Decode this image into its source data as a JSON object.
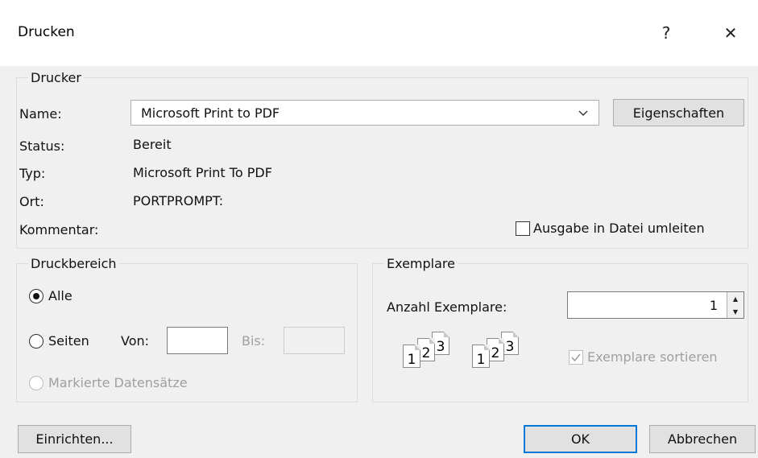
{
  "window": {
    "title": "Drucken",
    "help_icon": "?",
    "close_icon": "✕"
  },
  "printer_group": {
    "legend": "Drucker",
    "name_label": "Name:",
    "name_value": "Microsoft Print to PDF",
    "properties_button": "Eigenschaften",
    "status_label": "Status:",
    "status_value": "Bereit",
    "type_label": "Typ:",
    "type_value": "Microsoft Print To PDF",
    "location_label": "Ort:",
    "location_value": "PORTPROMPT:",
    "comment_label": "Kommentar:",
    "print_to_file_label": "Ausgabe in Datei umleiten",
    "print_to_file_checked": false
  },
  "range_group": {
    "legend": "Druckbereich",
    "all_label": "Alle",
    "pages_label": "Seiten",
    "from_label": "Von:",
    "from_value": "",
    "to_label": "Bis:",
    "to_value": "",
    "selected_records_label": "Markierte Datensätze",
    "selected": "all"
  },
  "copies_group": {
    "legend": "Exemplare",
    "count_label": "Anzahl Exemplare:",
    "count_value": "1",
    "collate_label": "Exemplare sortieren",
    "collate_checked": true,
    "collate_pages": [
      "1",
      "2",
      "3"
    ]
  },
  "footer": {
    "setup_button": "Einrichten...",
    "ok_button": "OK",
    "cancel_button": "Abbrechen"
  },
  "colors": {
    "accent": "#0078d7",
    "dialog_bg": "#f0f0f0",
    "titlebar_bg": "#ffffff"
  }
}
